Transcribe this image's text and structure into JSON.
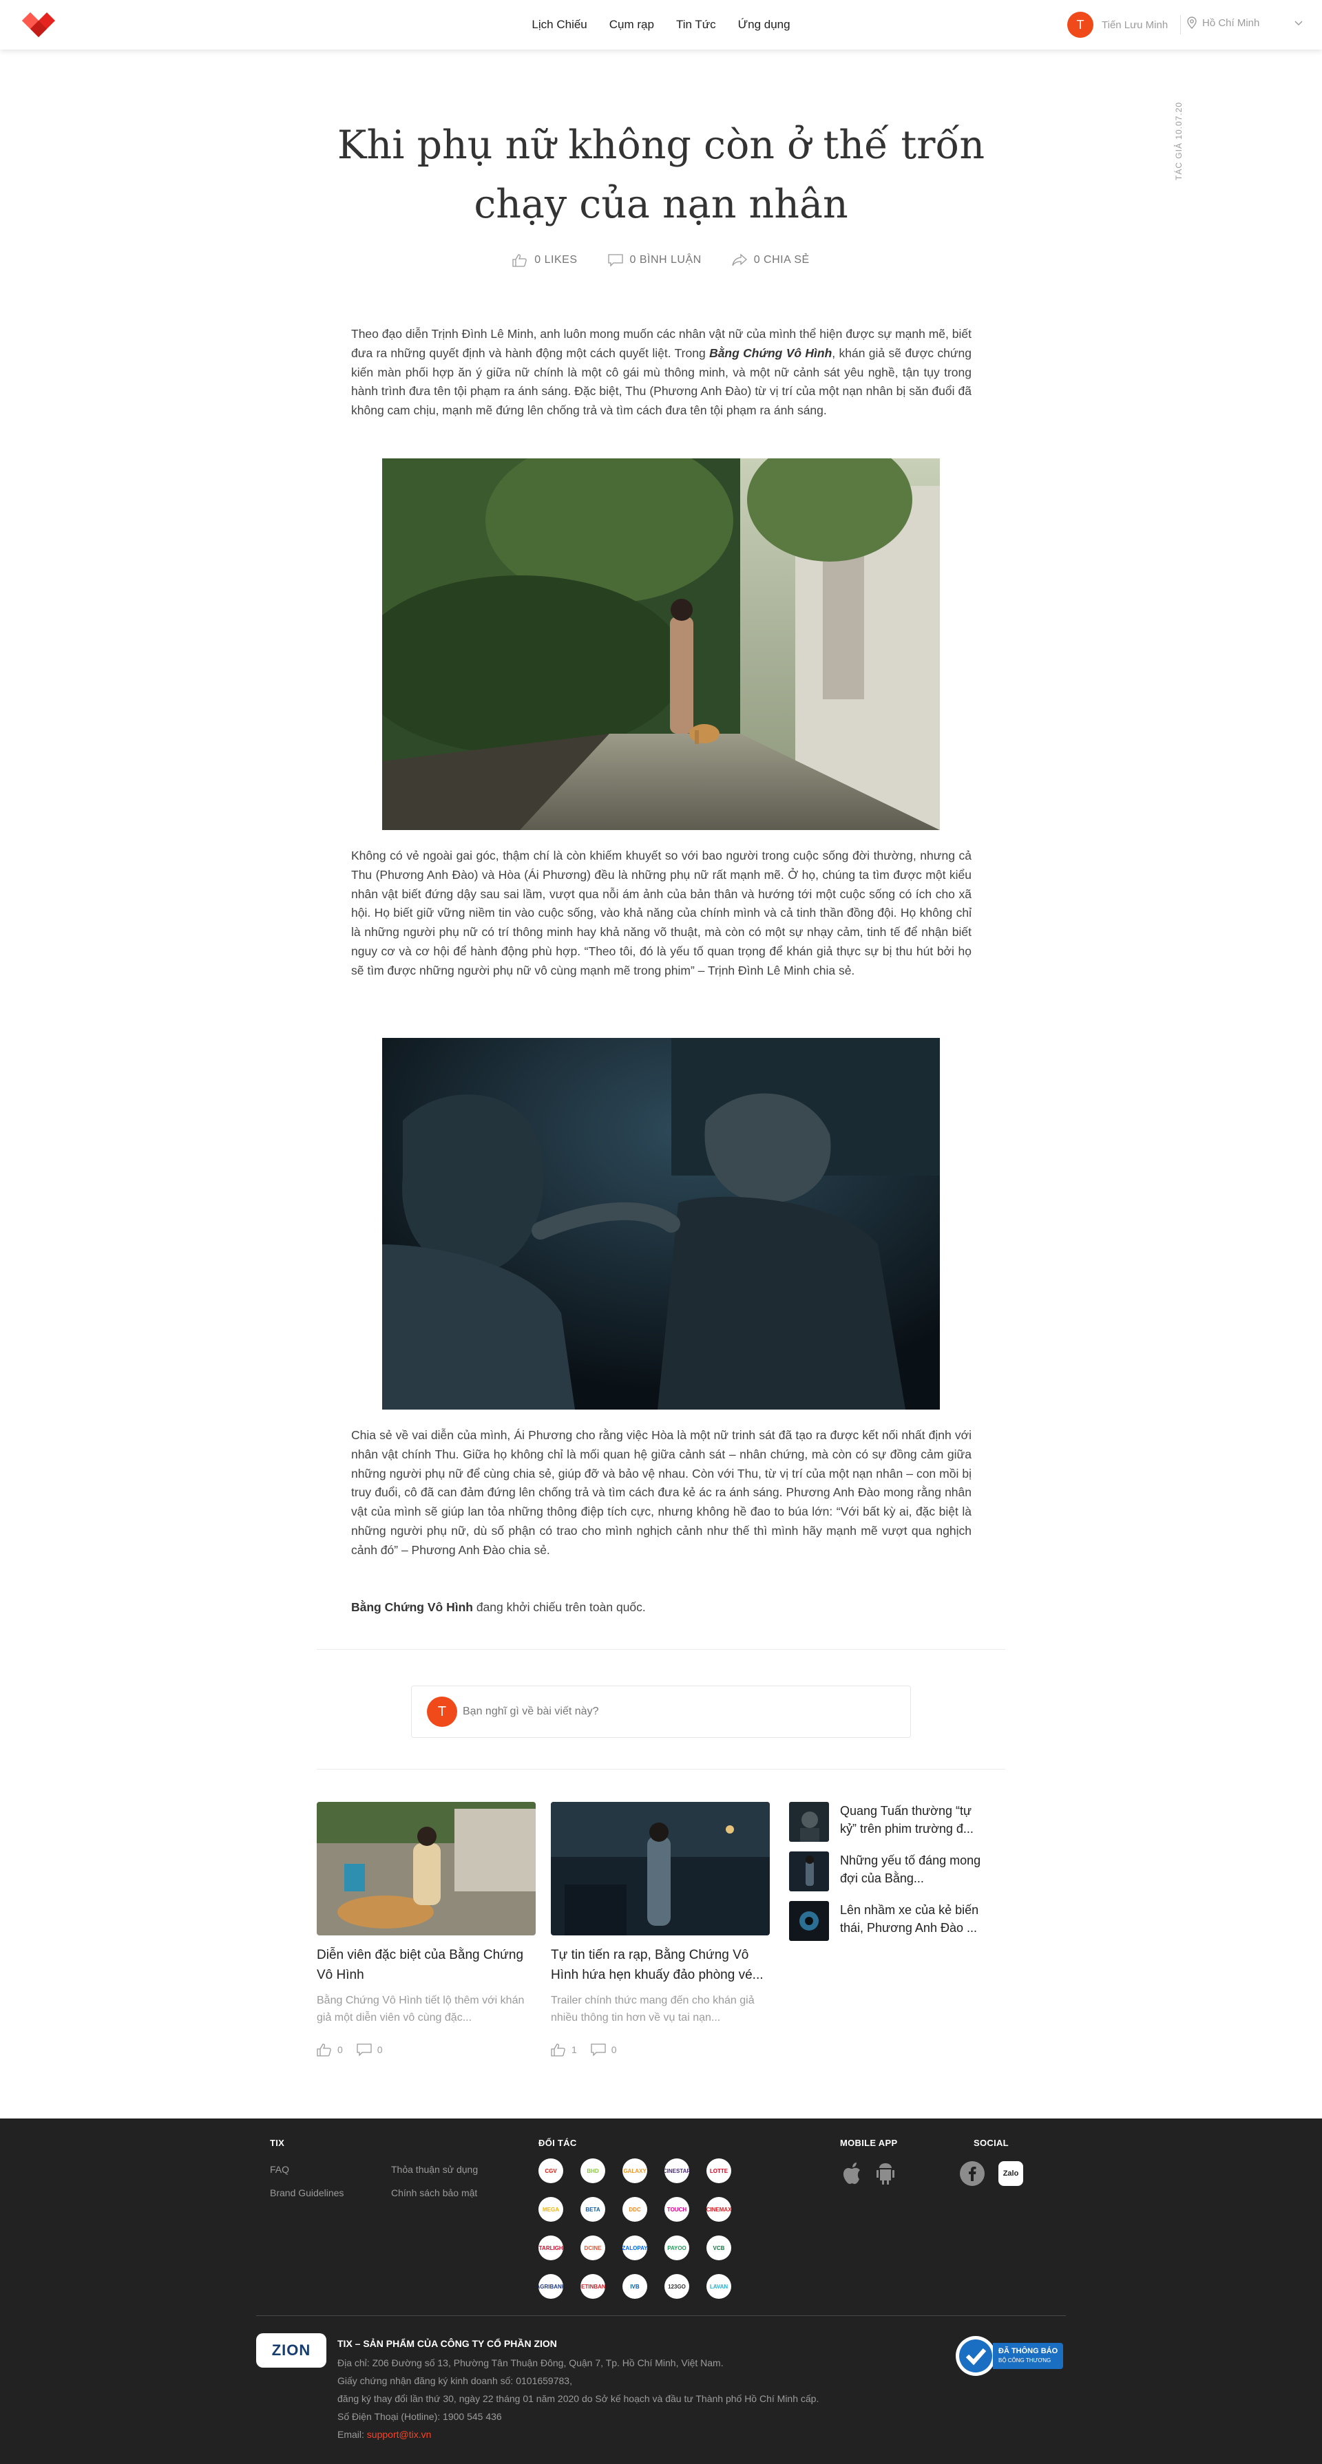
{
  "header": {
    "nav": [
      "Lịch Chiếu",
      "Cụm rạp",
      "Tin Tức",
      "Ứng dụng"
    ],
    "user_initial": "T",
    "user_name": "Tiến Lưu Minh",
    "location": "Hồ Chí Minh"
  },
  "article": {
    "title": "Khi phụ nữ không còn ở thế trốn chạy của nạn nhân",
    "author_meta": "TÁC GIẢ 10.07.20",
    "likes": "0 LIKES",
    "comments": "0 BÌNH LUẬN",
    "shares": "0 CHIA SẺ",
    "p1_a": "Theo đạo diễn Trịnh Đình Lê Minh, anh luôn mong muốn các nhân vật nữ của mình thể hiện được sự mạnh mẽ, biết đưa ra những quyết định và hành động một cách quyết liệt. Trong ",
    "p1_em": "Bằng Chứng Vô Hình",
    "p1_b": ", khán giả sẽ được chứng kiến màn phối hợp ăn ý giữa nữ chính là một cô gái mù thông minh, và một nữ cảnh sát yêu nghề, tận tụy trong hành trình đưa tên tội phạm ra ánh sáng. Đặc biệt, Thu (Phương Anh Đào) từ vị trí của một nạn nhân bị săn đuổi đã không cam chịu, mạnh mẽ đứng lên chống trả và tìm cách đưa tên tội phạm ra ánh sáng.",
    "p2": "Không có vẻ ngoài gai góc, thậm chí là còn khiếm khuyết so với bao người trong cuộc sống đời thường, nhưng cả Thu (Phương Anh Đào) và Hòa (Ái Phương) đều là những phụ nữ rất mạnh mẽ. Ở họ, chúng ta tìm được một kiểu nhân vật biết đứng dậy sau sai lầm, vượt qua nỗi ám ảnh của bản thân và hướng tới một cuộc sống có ích cho xã hội. Họ biết giữ vững niềm tin vào cuộc sống, vào khả năng của chính mình và cả tinh thần đồng đội. Họ không chỉ là những người phụ nữ có trí thông minh hay khả năng võ thuật, mà còn có một sự nhạy cảm, tinh tế để nhận biết nguy cơ và cơ hội để hành động phù hợp. “Theo tôi, đó là yếu tố quan trọng để khán giả thực sự bị thu hút bởi họ sẽ tìm được những người phụ nữ vô cùng mạnh mẽ trong phim” – Trịnh Đình Lê Minh chia sẻ.",
    "p3": "Chia sẻ về vai diễn của mình, Ái Phương cho rằng việc Hòa là một nữ trinh sát đã tạo ra được kết nối nhất định với nhân vật chính Thu. Giữa họ không chỉ là mối quan hệ giữa cảnh sát – nhân chứng, mà còn có sự đồng cảm giữa những người phụ nữ để cùng chia sẻ, giúp đỡ và bảo vệ nhau. Còn với Thu, từ vị trí của một nạn nhân – con mồi bị truy đuổi, cô đã can đảm đứng lên chống trả và tìm cách đưa kẻ ác ra ánh sáng. Phương Anh Đào mong rằng nhân vật của mình sẽ giúp lan tỏa những thông điệp tích cực, nhưng không hề đao to búa lớn: “Với bất kỳ ai, đặc biệt là những người phụ nữ, dù số phận có trao cho mình nghịch cảnh như thế thì mình hãy mạnh mẽ vượt qua nghịch cảnh đó” – Phương Anh Đào chia sẻ.",
    "p4_bold": "Bằng Chứng Vô Hình",
    "p4_rest": " đang khởi chiếu trên toàn quốc."
  },
  "comment": {
    "initial": "T",
    "placeholder": "Bạn nghĩ gì về bài viết này?"
  },
  "related": {
    "cards": [
      {
        "title": "Diễn viên đặc biệt của Bằng Chứng Vô Hình",
        "desc": "Bằng Chứng Vô Hình tiết lộ thêm với khán giả một diễn viên vô cùng đặc...",
        "likes": "0",
        "comments": "0"
      },
      {
        "title": "Tự tin tiến ra rạp, Bằng Chứng Vô Hình hứa hẹn khuấy đảo phòng vé...",
        "desc": "Trailer chính thức mang đến cho khán giả nhiều thông tin hơn về vụ tai nạn...",
        "likes": "1",
        "comments": "0"
      }
    ],
    "side": [
      "Quang Tuấn thường “tự kỷ” trên phim trường đ...",
      "Những yếu tố đáng mong đợi của Bằng...",
      "Lên nhầm xe của kẻ biến thái, Phương Anh Đào ..."
    ]
  },
  "footer": {
    "tix_head": "TIX",
    "tix_links": [
      "FAQ",
      "Brand Guidelines",
      "Thỏa thuận sử dụng",
      "Chính sách bảo mật"
    ],
    "partners_head": "ĐỐI TÁC",
    "partners": [
      "CGV",
      "BHD",
      "GALAXY",
      "CINESTAR",
      "LOTTE",
      "MEGA",
      "BETA",
      "DDC",
      "TOUCH",
      "CINEMAX",
      "STARLIGHT",
      "DCINE",
      "ZALOPAY",
      "PAYOO",
      "VCB",
      "AGRIBANK",
      "VIETINBANK",
      "IVB",
      "123GO",
      "LAVAN"
    ],
    "app_head": "MOBILE APP",
    "social_head": "SOCIAL",
    "zalo": "Zalo",
    "zion": "ZION",
    "company": "TIX – SẢN PHẨM CỦA CÔNG TY CỔ PHẦN ZION",
    "address": "Địa chỉ: Z06 Đường số 13, Phường Tân Thuận Đông, Quận 7, Tp. Hồ Chí Minh, Việt Nam.",
    "license1": "Giấy chứng nhận đăng ký kinh doanh số: 0101659783,",
    "license2": "đăng ký thay đổi lần thứ 30, ngày 22 tháng 01 năm 2020 do Sở kế hoạch và đầu tư Thành phố Hồ Chí Minh cấp.",
    "hotline": "Số Điện Thoại (Hotline): 1900 545 436",
    "email_label": "Email: ",
    "email": "support@tix.vn",
    "bct_line1": "ĐÃ THÔNG BÁO",
    "bct_line2": "BỘ CÔNG THƯƠNG"
  },
  "colors": {
    "brand": "#fb4226",
    "avatar": "#f04a1b",
    "footer_bg": "#222222"
  }
}
